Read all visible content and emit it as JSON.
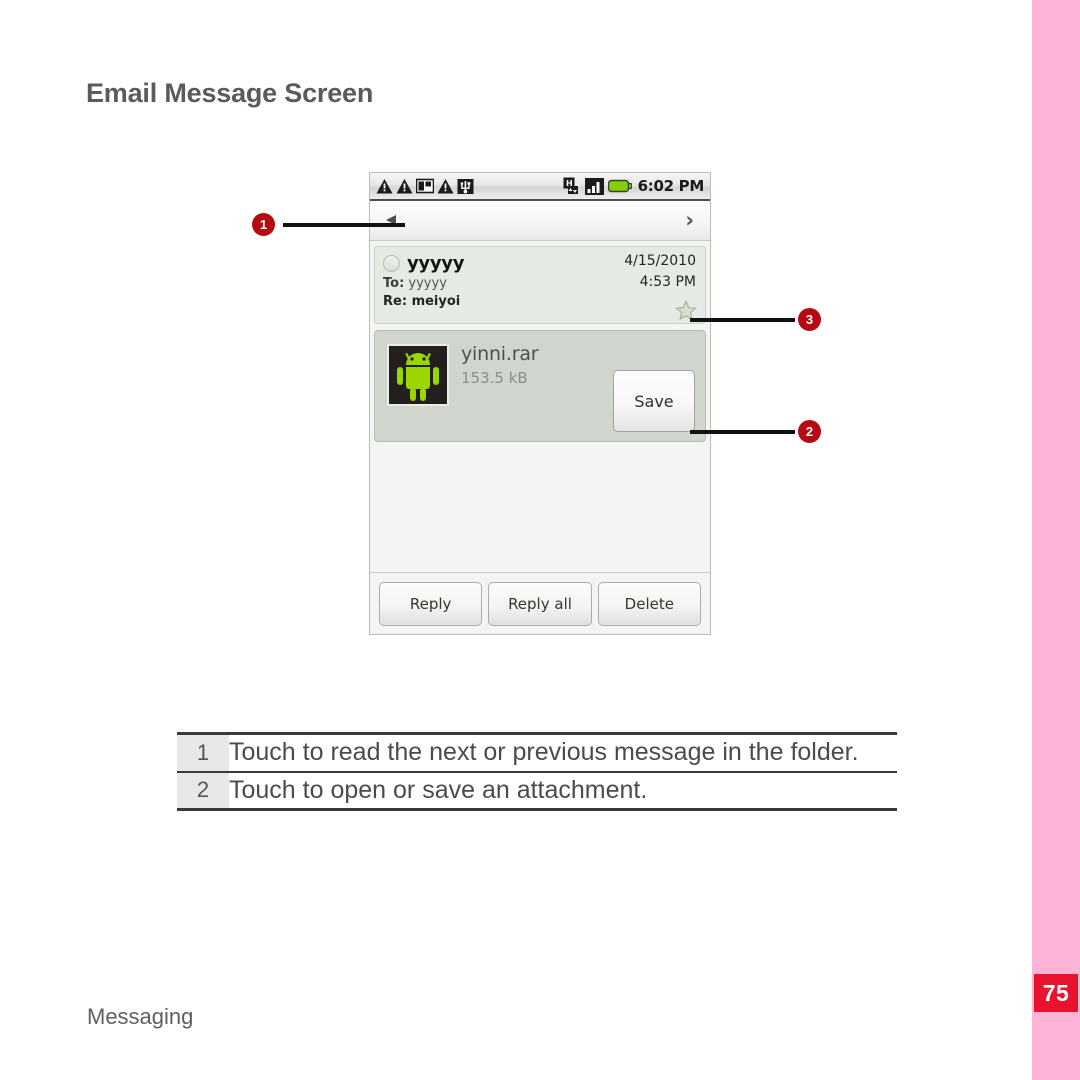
{
  "page": {
    "title": "Email Message Screen",
    "footer": "Messaging",
    "number": "75"
  },
  "phone": {
    "statusbar": {
      "icons": [
        "warning-triangle-icon",
        "warning-triangle-icon",
        "sim-card-icon",
        "warning-triangle-icon",
        "usb-icon"
      ],
      "network_icon": "hsdpa-icon",
      "signal_icon": "signal-bars-icon",
      "battery_icon": "battery-full-icon",
      "time": "6:02 PM"
    },
    "navbar": {
      "prev_icon": "previous-message-arrow-icon",
      "next_label": "›"
    },
    "message": {
      "sender": "yyyyy",
      "to_label": "To:",
      "to_value": "yyyyy",
      "subject_label": "Re:",
      "subject_value": "meiyoi",
      "date": "4/15/2010",
      "time": "4:53 PM",
      "star_icon": "star-outline-icon"
    },
    "attachment": {
      "thumb_icon": "android-robot-icon",
      "filename": "yinni.rar",
      "filesize": "153.5 kB",
      "save_label": "Save"
    },
    "actions": [
      {
        "label": "Reply"
      },
      {
        "label": "Reply all"
      },
      {
        "label": "Delete"
      }
    ]
  },
  "callouts": [
    {
      "number": "1"
    },
    {
      "number": "2"
    },
    {
      "number": "3"
    }
  ],
  "legend": {
    "rows": [
      {
        "number": "1",
        "text": "Touch to read the next or previous message in the folder."
      },
      {
        "number": "2",
        "text": "Touch to open or save an attachment."
      }
    ]
  },
  "colors": {
    "accent_red": "#e8142d",
    "callout_red": "#b50a11",
    "pink_band": "#fcb3d8",
    "android_green": "#9ad600"
  }
}
